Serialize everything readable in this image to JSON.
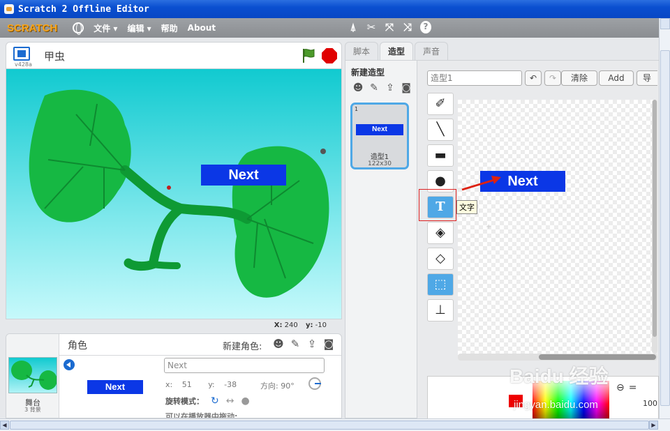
{
  "window": {
    "title": "Scratch 2 Offline Editor"
  },
  "menubar": {
    "logo": "SCRATCH",
    "items": [
      {
        "label": "文件",
        "has_dropdown": true
      },
      {
        "label": "编辑",
        "has_dropdown": true
      },
      {
        "label": "帮助",
        "has_dropdown": false
      },
      {
        "label": "About",
        "has_dropdown": false
      }
    ],
    "tool_icons": [
      "duplicate-icon",
      "delete-icon",
      "grow-icon",
      "shrink-icon",
      "help-icon"
    ]
  },
  "stage_header": {
    "version": "v428a",
    "sprite_name": "甲虫"
  },
  "stage": {
    "sprite_label": "Next",
    "coords": {
      "x_label": "X:",
      "x": "240",
      "y_label": "y:",
      "y": "-10"
    }
  },
  "sprites_panel": {
    "title": "角色",
    "new_sprite_label": "新建角色:",
    "stage_label": "舞台",
    "stage_backdrops": "3 背景",
    "selected_sprite": {
      "preview_text": "Next",
      "name_placeholder": "Next",
      "x_label": "x:",
      "x": "51",
      "y_label": "y:",
      "y": "-38",
      "direction_label": "方向:",
      "direction": "90°",
      "rotation_label": "旋转模式：",
      "drag_label": "可以在播放器中拖动:"
    }
  },
  "tabs": [
    {
      "label": "脚本",
      "active": false
    },
    {
      "label": "造型",
      "active": true
    },
    {
      "label": "声音",
      "active": false
    }
  ],
  "costumes": {
    "title": "新建造型",
    "items": [
      {
        "number": "1",
        "preview_text": "Next",
        "name": "造型1",
        "size": "122x30"
      }
    ]
  },
  "editor": {
    "costume_name": "造型1",
    "buttons": {
      "clear": "清除",
      "add": "Add",
      "import": "导入"
    },
    "tools": [
      {
        "name": "brush-tool",
        "icon": "brush-icon"
      },
      {
        "name": "line-tool",
        "icon": "line-icon"
      },
      {
        "name": "rectangle-tool",
        "icon": "rectangle-icon"
      },
      {
        "name": "ellipse-tool",
        "icon": "ellipse-icon"
      },
      {
        "name": "text-tool",
        "icon": "text-icon"
      },
      {
        "name": "fill-tool",
        "icon": "bucket-icon"
      },
      {
        "name": "eraser-tool",
        "icon": "eraser-icon"
      },
      {
        "name": "select-tool",
        "icon": "select-icon"
      },
      {
        "name": "stamp-tool",
        "icon": "stamp-icon"
      }
    ],
    "tooltip": "文字",
    "canvas_text": "Next",
    "zoom": "100"
  },
  "watermark": {
    "brand": "Baidu 经验",
    "url": "jingyan.baidu.com"
  },
  "colors": {
    "sprite_blue": "#0b37e6",
    "accent_blue": "#4fa8e6",
    "title_blue": "#0a4fd0"
  }
}
